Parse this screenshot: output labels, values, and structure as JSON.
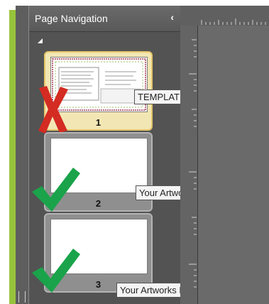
{
  "panel": {
    "title": "Page Navigation",
    "collapse_glyph": "‹",
    "pages": [
      {
        "number": "1",
        "tooltip": "TEMPLATE",
        "mark": "red-x",
        "selected": true
      },
      {
        "number": "2",
        "tooltip": "Your Artworks Here (Front)",
        "mark": "green-check",
        "selected": false
      },
      {
        "number": "3",
        "tooltip": "Your Artworks Here (Back)",
        "mark": "green-check",
        "selected": false
      }
    ]
  },
  "colors": {
    "accent_green": "#98c33c",
    "check_green": "#1aa34a",
    "x_red": "#d42b22"
  }
}
